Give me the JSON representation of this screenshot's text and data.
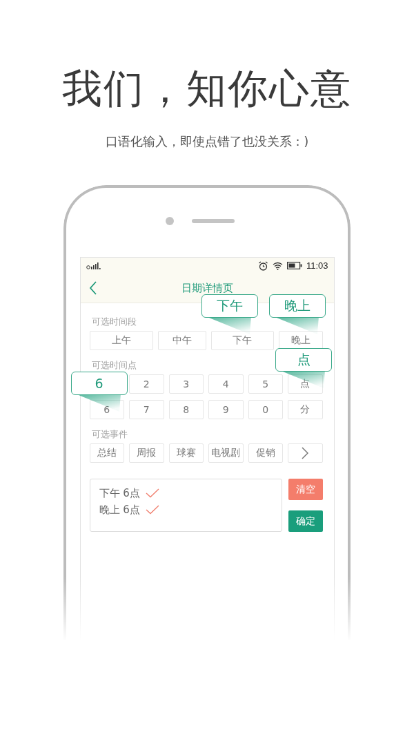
{
  "headline": "我们，知你心意",
  "subtitle": "口语化输入，即使点错了也没关系 : )",
  "status_bar": {
    "time": "11:03"
  },
  "header": {
    "title": "日期详情页"
  },
  "sections": [
    {
      "label": "可选时间段",
      "rows": [
        [
          {
            "kind": "key",
            "label": "上午"
          },
          {
            "kind": "key",
            "label": "中午"
          },
          {
            "kind": "key",
            "label": "下午",
            "popup": "下午"
          },
          {
            "kind": "key",
            "label": "晚上",
            "popup": "晚上"
          }
        ]
      ]
    },
    {
      "label": "可选时间点",
      "rows": [
        [
          {
            "kind": "covered",
            "popup": "6"
          },
          {
            "kind": "key",
            "label": "2"
          },
          {
            "kind": "key",
            "label": "3"
          },
          {
            "kind": "key",
            "label": "4"
          },
          {
            "kind": "key",
            "label": "5"
          },
          {
            "kind": "key",
            "label": "点",
            "popup": "点"
          }
        ],
        [
          {
            "kind": "key",
            "label": "6"
          },
          {
            "kind": "key",
            "label": "7"
          },
          {
            "kind": "key",
            "label": "8"
          },
          {
            "kind": "key",
            "label": "9"
          },
          {
            "kind": "key",
            "label": "0"
          },
          {
            "kind": "key",
            "label": "分"
          }
        ]
      ]
    },
    {
      "label": "可选事件",
      "rows": [
        [
          {
            "kind": "key",
            "label": "总结"
          },
          {
            "kind": "key",
            "label": "周报"
          },
          {
            "kind": "key",
            "label": "球赛"
          },
          {
            "kind": "key",
            "label": "电视剧"
          },
          {
            "kind": "key",
            "label": "促销"
          },
          {
            "kind": "more"
          }
        ]
      ]
    }
  ],
  "results": [
    {
      "text": "下午 6点",
      "checked": true
    },
    {
      "text": "晚上 6点",
      "checked": true
    }
  ],
  "buttons": [
    {
      "kind": "clear",
      "label": "清空"
    },
    {
      "kind": "confirm",
      "label": "确定"
    }
  ]
}
